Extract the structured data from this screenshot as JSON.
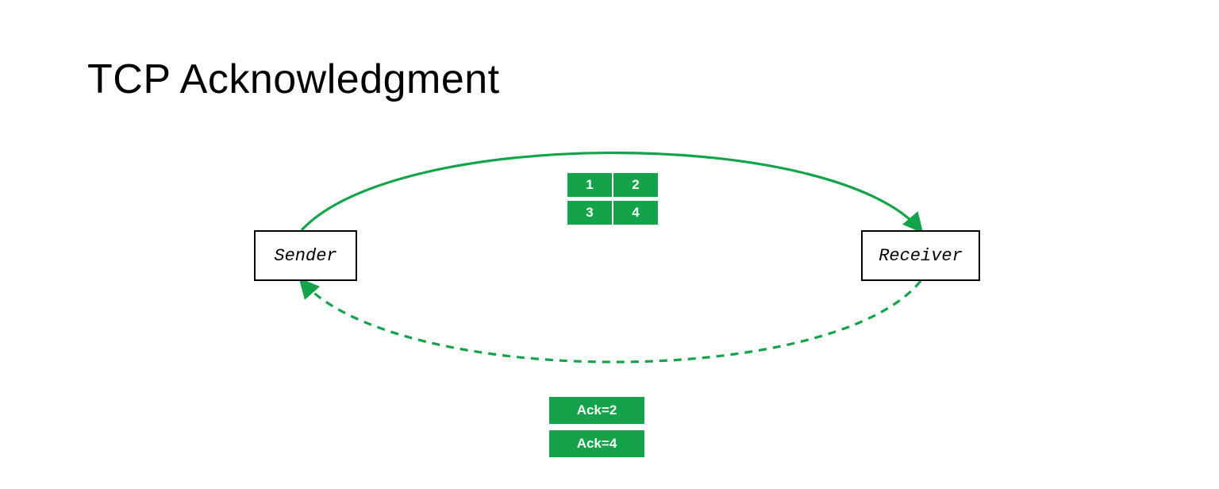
{
  "title": "TCP Acknowledgment",
  "nodes": {
    "sender": "Sender",
    "receiver": "Receiver"
  },
  "packets": {
    "row1": [
      "1",
      "2"
    ],
    "row2": [
      "3",
      "4"
    ]
  },
  "acks": [
    "Ack=2",
    "Ack=4"
  ],
  "colors": {
    "accent": "#14a34a"
  },
  "arrows": {
    "forward": {
      "style": "solid",
      "direction": "sender-to-receiver"
    },
    "back": {
      "style": "dashed",
      "direction": "receiver-to-sender"
    }
  }
}
